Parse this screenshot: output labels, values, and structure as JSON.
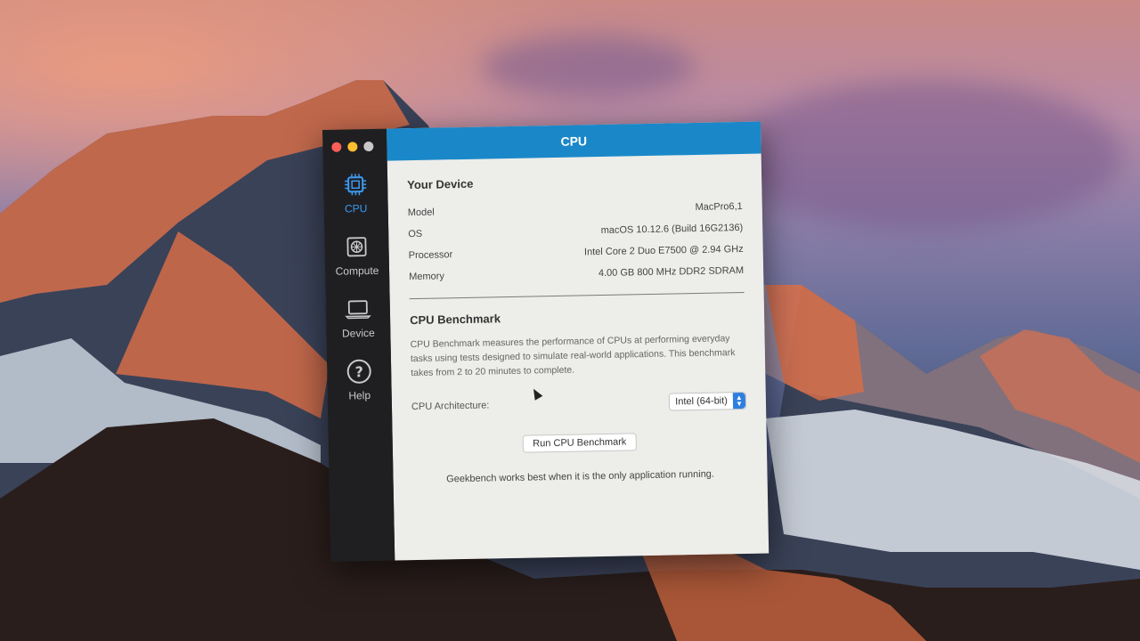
{
  "window": {
    "title": "CPU",
    "traffic_lights": [
      "close",
      "minimize",
      "zoom"
    ]
  },
  "sidebar": {
    "items": [
      {
        "label": "CPU",
        "icon": "cpu-chip-icon",
        "active": true
      },
      {
        "label": "Compute",
        "icon": "gpu-card-icon",
        "active": false
      },
      {
        "label": "Device",
        "icon": "laptop-icon",
        "active": false
      },
      {
        "label": "Help",
        "icon": "question-circle-icon",
        "active": false
      }
    ]
  },
  "device": {
    "heading": "Your Device",
    "rows": [
      {
        "label": "Model",
        "value": "MacPro6,1"
      },
      {
        "label": "OS",
        "value": "macOS 10.12.6 (Build 16G2136)"
      },
      {
        "label": "Processor",
        "value": "Intel Core 2 Duo E7500 @ 2.94 GHz"
      },
      {
        "label": "Memory",
        "value": "4.00 GB 800 MHz DDR2 SDRAM"
      }
    ]
  },
  "benchmark": {
    "heading": "CPU Benchmark",
    "description": "CPU Benchmark measures the performance of CPUs at performing everyday tasks using tests designed to simulate real-world applications. This benchmark takes from 2 to 20 minutes to complete.",
    "architecture_label": "CPU Architecture:",
    "architecture_value": "Intel (64-bit)",
    "run_button": "Run CPU Benchmark",
    "note": "Geekbench works best when it is the only application running."
  },
  "colors": {
    "titlebar": "#1a88c8",
    "accent": "#3d9af0",
    "sidebar": "#1f1f22"
  }
}
